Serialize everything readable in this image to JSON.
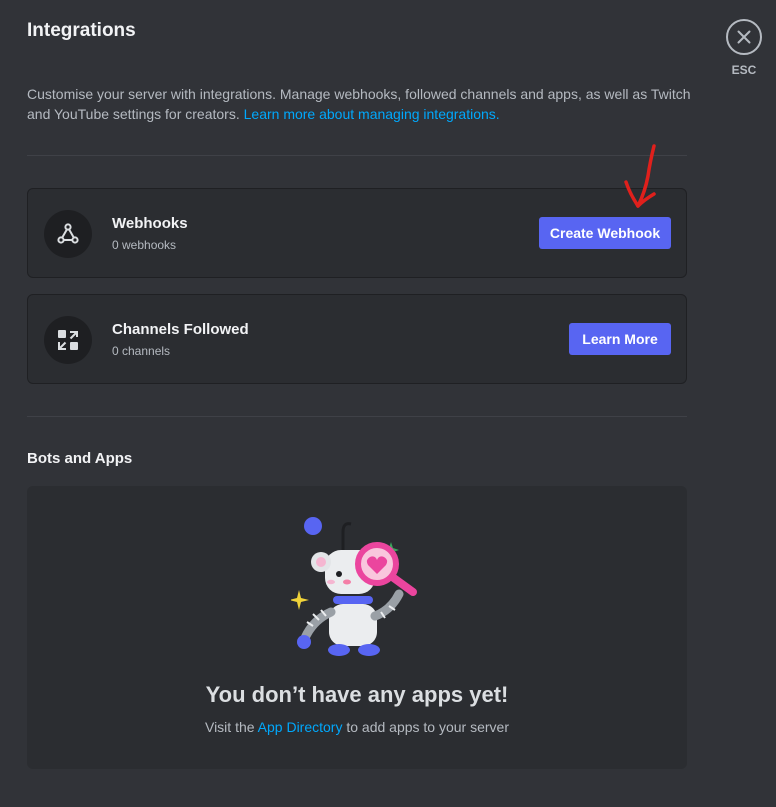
{
  "page": {
    "title": "Integrations",
    "close_label": "ESC"
  },
  "description": {
    "text": "Customise your server with integrations. Manage webhooks, followed channels and apps, as well as Twitch and YouTube settings for creators. ",
    "link": "Learn more about managing integrations."
  },
  "cards": [
    {
      "title": "Webhooks",
      "subtitle": "0 webhooks",
      "button": "Create Webhook",
      "icon": "webhook-icon"
    },
    {
      "title": "Channels Followed",
      "subtitle": "0 channels",
      "button": "Learn More",
      "icon": "channels-followed-icon"
    }
  ],
  "bots_and_apps": {
    "heading": "Bots and Apps",
    "empty_title": "You don’t have any apps yet!",
    "empty_text_before": "Visit the ",
    "empty_link": "App Directory",
    "empty_text_after": " to add apps to your server"
  },
  "colors": {
    "background": "#313338",
    "card": "#2b2d31",
    "brand": "#5865f2",
    "link": "#00a8fc",
    "annotation": "#e0201c"
  }
}
